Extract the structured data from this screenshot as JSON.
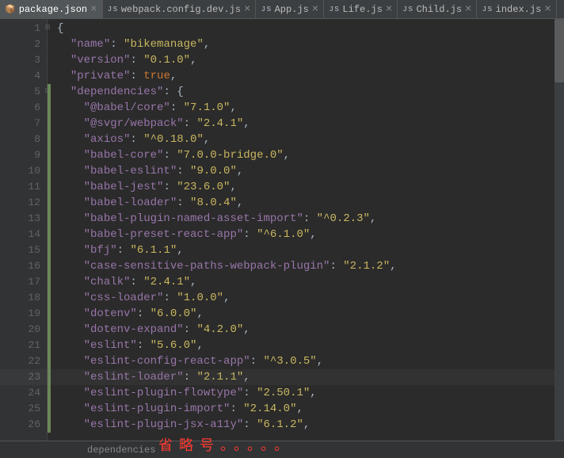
{
  "tabs": [
    {
      "label": "package.json",
      "icon": "📄",
      "active": true
    },
    {
      "label": "webpack.config.dev.js",
      "icon": "JS",
      "active": false
    },
    {
      "label": "App.js",
      "icon": "JS",
      "active": false
    },
    {
      "label": "Life.js",
      "icon": "JS",
      "active": false
    },
    {
      "label": "Child.js",
      "icon": "JS",
      "active": false
    },
    {
      "label": "index.js",
      "icon": "JS",
      "active": false
    }
  ],
  "breadcrumb": "dependencies",
  "annotation": "省略号。。。。。",
  "lines": [
    {
      "n": 1,
      "indent": "",
      "text_a": "{",
      "kind": "plain"
    },
    {
      "n": 2,
      "indent": "  ",
      "key": "\"name\"",
      "sep": ": ",
      "val": "\"bikemanage\"",
      "comma": ","
    },
    {
      "n": 3,
      "indent": "  ",
      "key": "\"version\"",
      "sep": ": ",
      "val": "\"0.1.0\"",
      "comma": ","
    },
    {
      "n": 4,
      "indent": "  ",
      "key": "\"private\"",
      "sep": ": ",
      "kw": "true",
      "comma": ","
    },
    {
      "n": 5,
      "indent": "  ",
      "key": "\"dependencies\"",
      "sep": ": ",
      "open": "{"
    },
    {
      "n": 6,
      "indent": "    ",
      "key": "\"@babel/core\"",
      "sep": ": ",
      "val": "\"7.1.0\"",
      "comma": ","
    },
    {
      "n": 7,
      "indent": "    ",
      "key": "\"@svgr/webpack\"",
      "sep": ": ",
      "val": "\"2.4.1\"",
      "comma": ","
    },
    {
      "n": 8,
      "indent": "    ",
      "key": "\"axios\"",
      "sep": ": ",
      "val": "\"^0.18.0\"",
      "comma": ","
    },
    {
      "n": 9,
      "indent": "    ",
      "key": "\"babel-core\"",
      "sep": ": ",
      "val": "\"7.0.0-bridge.0\"",
      "comma": ","
    },
    {
      "n": 10,
      "indent": "    ",
      "key": "\"babel-eslint\"",
      "sep": ": ",
      "val": "\"9.0.0\"",
      "comma": ","
    },
    {
      "n": 11,
      "indent": "    ",
      "key": "\"babel-jest\"",
      "sep": ": ",
      "val": "\"23.6.0\"",
      "comma": ","
    },
    {
      "n": 12,
      "indent": "    ",
      "key": "\"babel-loader\"",
      "sep": ": ",
      "val": "\"8.0.4\"",
      "comma": ","
    },
    {
      "n": 13,
      "indent": "    ",
      "key": "\"babel-plugin-named-asset-import\"",
      "sep": ": ",
      "val": "\"^0.2.3\"",
      "comma": ","
    },
    {
      "n": 14,
      "indent": "    ",
      "key": "\"babel-preset-react-app\"",
      "sep": ": ",
      "val": "\"^6.1.0\"",
      "comma": ","
    },
    {
      "n": 15,
      "indent": "    ",
      "key": "\"bfj\"",
      "sep": ": ",
      "val": "\"6.1.1\"",
      "comma": ","
    },
    {
      "n": 16,
      "indent": "    ",
      "key": "\"case-sensitive-paths-webpack-plugin\"",
      "sep": ": ",
      "val": "\"2.1.2\"",
      "comma": ","
    },
    {
      "n": 17,
      "indent": "    ",
      "key": "\"chalk\"",
      "sep": ": ",
      "val": "\"2.4.1\"",
      "comma": ","
    },
    {
      "n": 18,
      "indent": "    ",
      "key": "\"css-loader\"",
      "sep": ": ",
      "val": "\"1.0.0\"",
      "comma": ","
    },
    {
      "n": 19,
      "indent": "    ",
      "key": "\"dotenv\"",
      "sep": ": ",
      "val": "\"6.0.0\"",
      "comma": ","
    },
    {
      "n": 20,
      "indent": "    ",
      "key": "\"dotenv-expand\"",
      "sep": ": ",
      "val": "\"4.2.0\"",
      "comma": ","
    },
    {
      "n": 21,
      "indent": "    ",
      "key": "\"eslint\"",
      "sep": ": ",
      "val": "\"5.6.0\"",
      "comma": ","
    },
    {
      "n": 22,
      "indent": "    ",
      "key": "\"eslint-config-react-app\"",
      "sep": ": ",
      "val": "\"^3.0.5\"",
      "comma": ","
    },
    {
      "n": 23,
      "indent": "    ",
      "key": "\"eslint-loader\"",
      "sep": ": ",
      "val": "\"2.1.1\"",
      "comma": ",",
      "hl": true
    },
    {
      "n": 24,
      "indent": "    ",
      "key": "\"eslint-plugin-flowtype\"",
      "sep": ": ",
      "val": "\"2.50.1\"",
      "comma": ","
    },
    {
      "n": 25,
      "indent": "    ",
      "key": "\"eslint-plugin-import\"",
      "sep": ": ",
      "val": "\"2.14.0\"",
      "comma": ","
    },
    {
      "n": 26,
      "indent": "    ",
      "key": "\"eslint-plugin-jsx-a11y\"",
      "sep": ": ",
      "val": "\"6.1.2\"",
      "comma": ","
    }
  ]
}
